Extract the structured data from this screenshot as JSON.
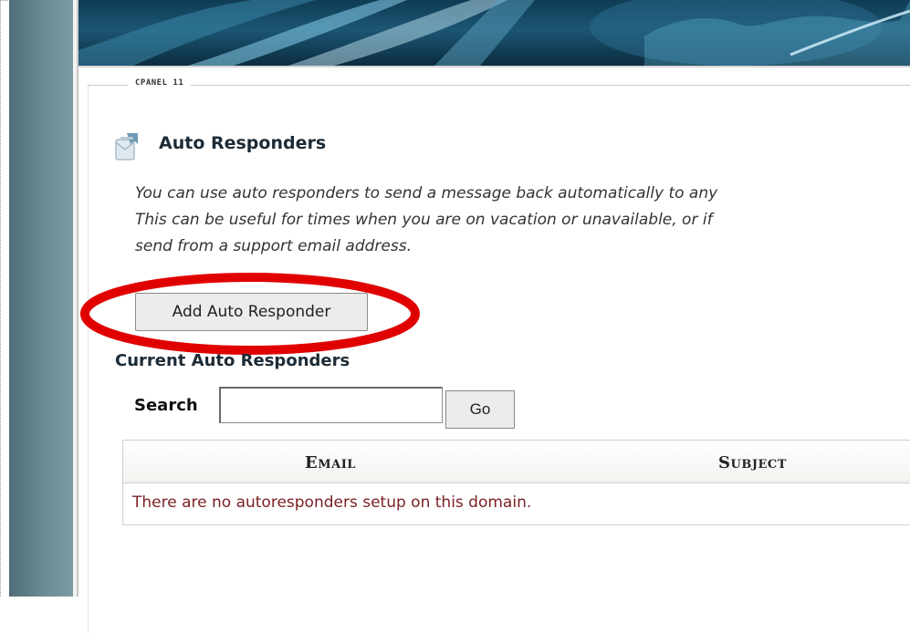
{
  "header": {
    "version_label": "CPANEL 11"
  },
  "page": {
    "title": "Auto Responders",
    "icon": "autoresponder-icon",
    "description_lines": [
      "You can use auto responders to send a message back automatically to any",
      "This can be useful for times when you are on vacation or unavailable, or if",
      "send from a support email address."
    ]
  },
  "actions": {
    "add_label": "Add Auto Responder",
    "highlight_color": "#e00000"
  },
  "current": {
    "title": "Current Auto Responders",
    "search_label": "Search",
    "search_value": "",
    "go_label": "Go"
  },
  "table": {
    "columns": [
      "Email",
      "Subject"
    ],
    "empty_message": "There are no autoresponders setup on this domain."
  }
}
